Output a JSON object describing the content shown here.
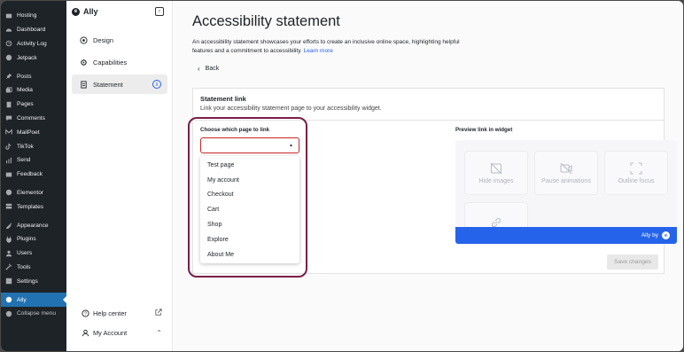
{
  "wp_menu": [
    {
      "label": "Hosting",
      "icon": "hosting-icon"
    },
    {
      "label": "Dashboard",
      "icon": "dashboard-icon"
    },
    {
      "label": "Activity Log",
      "icon": "activity-log-icon"
    },
    {
      "label": "Jetpack",
      "icon": "jetpack-icon"
    },
    {
      "label": "Posts",
      "icon": "pin-icon"
    },
    {
      "label": "Media",
      "icon": "media-icon"
    },
    {
      "label": "Pages",
      "icon": "pages-icon"
    },
    {
      "label": "Comments",
      "icon": "comments-icon"
    },
    {
      "label": "MailPoet",
      "icon": "mailpoet-icon"
    },
    {
      "label": "TikTok",
      "icon": "tiktok-icon"
    },
    {
      "label": "Send",
      "icon": "send-icon"
    },
    {
      "label": "Feedback",
      "icon": "feedback-icon"
    },
    {
      "label": "Elementor",
      "icon": "elementor-icon"
    },
    {
      "label": "Templates",
      "icon": "templates-icon"
    },
    {
      "label": "Appearance",
      "icon": "appearance-icon"
    },
    {
      "label": "Plugins",
      "icon": "plugins-icon"
    },
    {
      "label": "Users",
      "icon": "users-icon"
    },
    {
      "label": "Tools",
      "icon": "tools-icon"
    },
    {
      "label": "Settings",
      "icon": "settings-icon"
    },
    {
      "label": "Ally",
      "icon": "ally-icon"
    },
    {
      "label": "Collapse menu",
      "icon": "collapse-icon"
    }
  ],
  "ally_sidebar": {
    "title": "Ally",
    "nav": [
      {
        "label": "Design",
        "icon": "design-icon"
      },
      {
        "label": "Capabilities",
        "icon": "capabilities-icon"
      },
      {
        "label": "Statement",
        "icon": "statement-icon"
      }
    ],
    "help_center": "Help center",
    "my_account": "My Account"
  },
  "main": {
    "title": "Accessibility statement",
    "description": "An accessibility statement showcases your efforts to create an inclusive online space, highlighting helpful features and a commitment to accessibility.",
    "learn_more": "Learn more",
    "back": "Back"
  },
  "statement_card": {
    "title": "Statement link",
    "subtitle": "Link your accessibility statement page to your accessibility widget.",
    "field_label": "Choose which page to link",
    "select_value": "",
    "options": [
      "Test page",
      "My account",
      "Checkout",
      "Cart",
      "Shop",
      "Explore",
      "About Me"
    ],
    "preview_label": "Preview link in widget",
    "tiles": [
      "Hide images",
      "Pause animations",
      "Outline focus"
    ],
    "ally_bar_text": "Ally by",
    "save_label": "Save changes"
  },
  "colors": {
    "wp_sidebar_bg": "#1d2327",
    "wp_active": "#2271b1",
    "accent": "#2563eb",
    "highlight_ring": "#7a1f46",
    "select_error_border": "#c62828"
  }
}
